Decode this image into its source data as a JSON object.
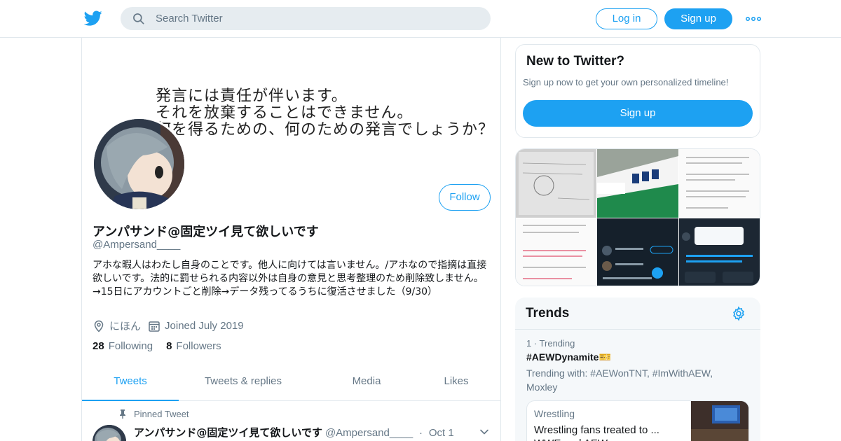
{
  "topbar": {
    "search_placeholder": "Search Twitter",
    "login_label": "Log in",
    "signup_label": "Sign up",
    "logo_icon": "twitter-bird-icon",
    "more_icon": "more-dots-icon",
    "accent_color": "#1da1f2"
  },
  "profile": {
    "banner_text": "発言には責任が伴います。\nそれを放棄することはできません。\n何を得るための、何のための発言でしょうか？",
    "display_name": "アンパサンド@固定ツイ見て欲しいです",
    "handle": "@Ampersand____",
    "bio": "アホな暇人はわたし自身のことです。他人に向けては言いません。/アホなので指摘は直接欲しいです。法的に罰せられる内容以外は自身の意見と思考整理のため削除致しません。→15日にアカウントごと削除→データ残ってるうちに復活させました（9/30）",
    "location": "にほん",
    "joined": "Joined July 2019",
    "following_count": "28",
    "following_label": "Following",
    "followers_count": "8",
    "followers_label": "Followers",
    "follow_label": "Follow"
  },
  "tabs": [
    {
      "label": "Tweets",
      "active": true
    },
    {
      "label": "Tweets & replies",
      "active": false
    },
    {
      "label": "Media",
      "active": false
    },
    {
      "label": "Likes",
      "active": false
    }
  ],
  "pinned_tweet": {
    "pinned_label": "Pinned Tweet",
    "author_name": "アンパサンド@固定ツイ見て欲しいです",
    "author_handle": "@Ampersand____",
    "separator": "·",
    "date": "Oct 1"
  },
  "sidebar": {
    "new_title": "New to Twitter?",
    "new_subtitle": "Sign up now to get your own personalized timeline!",
    "new_signup_label": "Sign up",
    "trends_title": "Trends",
    "trend": {
      "rank_meta": "1 · Trending",
      "name": "#AEWDynamite",
      "emoji": "🎫",
      "with": "Trending with: #AEWonTNT, #ImWithAEW, Moxley"
    },
    "trend_card": {
      "category": "Wrestling",
      "text": "Wrestling fans treated to ... WWE and AEW"
    }
  },
  "gallery": [
    {
      "name": "media-thumb-notes"
    },
    {
      "name": "media-thumb-sign"
    },
    {
      "name": "media-thumb-text-1"
    },
    {
      "name": "media-thumb-text-2"
    },
    {
      "name": "media-thumb-app-1"
    },
    {
      "name": "media-thumb-app-2"
    }
  ]
}
